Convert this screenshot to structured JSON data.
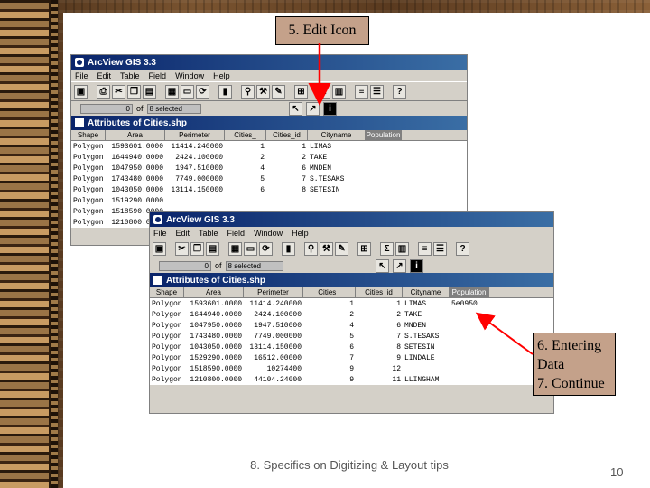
{
  "callouts": {
    "edit_icon": "5. Edit Icon",
    "entering_line1": "6. Entering",
    "entering_line2": "Data",
    "entering_line3": "7. Continue"
  },
  "footer": {
    "text": "8. Specifics on Digitizing & Layout tips",
    "page": "10"
  },
  "colors": {
    "titlebar": "#0a246a",
    "callout": "#c4a18a",
    "arrow": "#ff0000"
  },
  "back_window": {
    "title": "ArcView GIS 3.3",
    "menus": [
      "File",
      "Edit",
      "Table",
      "Field",
      "Window",
      "Help"
    ],
    "count": "0",
    "of": "of",
    "selected": "8 selected",
    "table_title": "Attributes of Cities.shp",
    "columns": [
      "Shape",
      "Area",
      "Perimeter",
      "Cities_",
      "Cities_id",
      "Cityname",
      "Population"
    ],
    "rows": [
      [
        "Polygon",
        "1593601.0000",
        "11414.240000",
        "1",
        "1",
        "LIMAS",
        ""
      ],
      [
        "Polygon",
        "1644940.0000",
        "2424.100000",
        "2",
        "2",
        "TAKE",
        ""
      ],
      [
        "Polygon",
        "1047950.0000",
        "1947.510000",
        "4",
        "6",
        "MNDEN",
        ""
      ],
      [
        "Polygon",
        "1743480.0000",
        "7749.000000",
        "5",
        "7",
        "S.TESAKS",
        ""
      ],
      [
        "Polygon",
        "1043050.0000",
        "13114.150000",
        "6",
        "8",
        "SETESIN",
        ""
      ],
      [
        "Polygon",
        "1519290.0000",
        "",
        "",
        "",
        "",
        ""
      ],
      [
        "Polygon",
        "1518590.0000",
        "",
        "",
        "",
        "",
        ""
      ],
      [
        "Polygon",
        "1210800.0000",
        "",
        "",
        "",
        "",
        ""
      ]
    ]
  },
  "front_window": {
    "title": "ArcView GIS 3.3",
    "menus": [
      "File",
      "Edit",
      "Table",
      "Field",
      "Window",
      "Help"
    ],
    "count": "0",
    "of": "of",
    "selected": "8 selected",
    "table_title": "Attributes of Cities.shp",
    "columns": [
      "Shape",
      "Area",
      "Perimeter",
      "Cities_",
      "Cities_id",
      "Cityname",
      "Population"
    ],
    "rows": [
      [
        "Polygon",
        "1593601.0000",
        "11414.240000",
        "1",
        "1",
        "LIMAS",
        "5e0950"
      ],
      [
        "Polygon",
        "1644940.0000",
        "2424.100000",
        "2",
        "2",
        "TAKE",
        ""
      ],
      [
        "Polygon",
        "1047950.0000",
        "1947.510000",
        "4",
        "6",
        "MNDEN",
        ""
      ],
      [
        "Polygon",
        "1743480.0000",
        "7749.000000",
        "5",
        "7",
        "S.TESAKS",
        ""
      ],
      [
        "Polygon",
        "1043050.0000",
        "13114.150000",
        "6",
        "8",
        "SETESIN",
        ""
      ],
      [
        "Polygon",
        "1529290.0000",
        "16512.00000",
        "7",
        "9",
        "LINDALE",
        ""
      ],
      [
        "Polygon",
        "1518590.0000",
        "10274400",
        "9",
        "12",
        "",
        ""
      ],
      [
        "Polygon",
        "1210800.0000",
        "44104.24000",
        "9",
        "11",
        "LLINGHAM",
        ""
      ]
    ]
  }
}
